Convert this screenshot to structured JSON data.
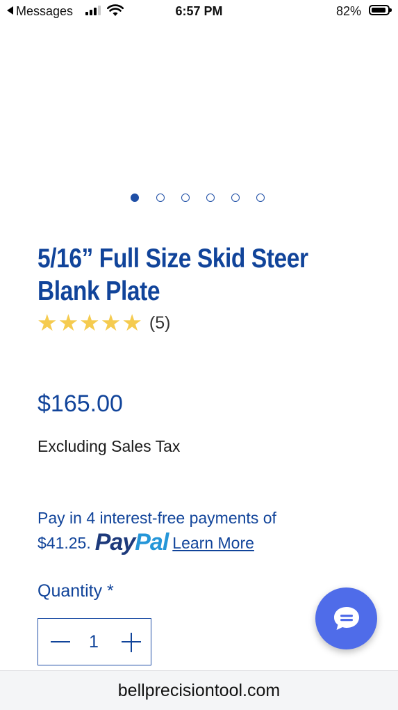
{
  "status_bar": {
    "back_label": "Messages",
    "time": "6:57 PM",
    "battery_percent": "82%",
    "battery_level": 0.82,
    "signal_bars": 3,
    "icons": [
      "signal-icon",
      "wifi-icon",
      "battery-icon"
    ]
  },
  "carousel": {
    "slide_count": 6,
    "active_index": 0
  },
  "product": {
    "title_line1": "5/16” Full Size Skid Steer",
    "title_line2": "Blank Plate",
    "stars": "★★★★★",
    "rating_value": 5,
    "rating_count": "(5)",
    "price": "$165.00",
    "tax_note": "Excluding Sales Tax"
  },
  "paypal": {
    "text_line1": "Pay in 4 interest-free payments of",
    "installment": "$41.25.",
    "logo_pay": "Pay",
    "logo_pal": "Pal",
    "learn_more": "Learn More"
  },
  "quantity": {
    "label": "Quantity *",
    "value": "1"
  },
  "chat": {
    "icon": "chat-icon"
  },
  "browser": {
    "url": "bellprecisiontool.com"
  },
  "colors": {
    "brand_blue": "#11449a",
    "star_gold": "#f5cb4f",
    "chat_blue": "#4f6ce9",
    "paypal_dark": "#1d3a7b",
    "paypal_light": "#2596d8"
  }
}
